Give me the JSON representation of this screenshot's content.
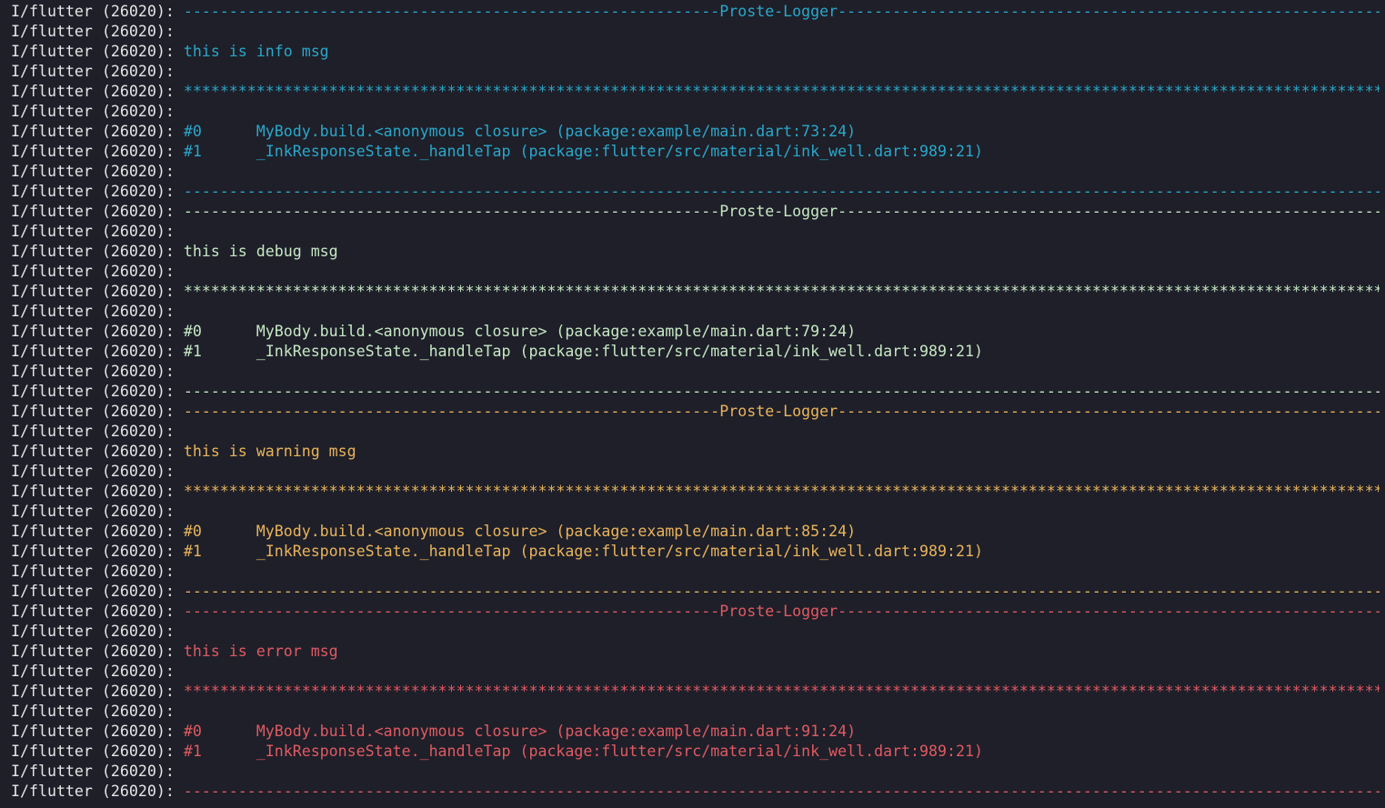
{
  "console": {
    "prefix": "I/flutter (26020): ",
    "colors": {
      "prefix": "#e6e6e6",
      "info": "#2aa7c9",
      "debug": "#c7e8c3",
      "warning": "#e9b45b",
      "error": "#e05a62"
    },
    "lines": [
      {
        "text": "-----------------------------------------------------------Proste-Logger-------------------------------------------------------------",
        "level": "info"
      },
      {
        "text": "",
        "level": "info"
      },
      {
        "text": "this is info msg",
        "level": "info"
      },
      {
        "text": "",
        "level": "info"
      },
      {
        "text": "************************************************************************************************************************************",
        "level": "info"
      },
      {
        "text": "",
        "level": "info"
      },
      {
        "text": "#0      MyBody.build.<anonymous closure> (package:example/main.dart:73:24)",
        "level": "info"
      },
      {
        "text": "#1      _InkResponseState._handleTap (package:flutter/src/material/ink_well.dart:989:21)",
        "level": "info"
      },
      {
        "text": "",
        "level": "info"
      },
      {
        "text": "------------------------------------------------------------------------------------------------------------------------------------",
        "level": "info"
      },
      {
        "text": "-----------------------------------------------------------Proste-Logger-------------------------------------------------------------",
        "level": "debug"
      },
      {
        "text": "",
        "level": "debug"
      },
      {
        "text": "this is debug msg",
        "level": "debug"
      },
      {
        "text": "",
        "level": "debug"
      },
      {
        "text": "************************************************************************************************************************************",
        "level": "debug"
      },
      {
        "text": "",
        "level": "debug"
      },
      {
        "text": "#0      MyBody.build.<anonymous closure> (package:example/main.dart:79:24)",
        "level": "debug"
      },
      {
        "text": "#1      _InkResponseState._handleTap (package:flutter/src/material/ink_well.dart:989:21)",
        "level": "debug"
      },
      {
        "text": "",
        "level": "debug"
      },
      {
        "text": "------------------------------------------------------------------------------------------------------------------------------------",
        "level": "debug"
      },
      {
        "text": "-----------------------------------------------------------Proste-Logger-------------------------------------------------------------",
        "level": "warning"
      },
      {
        "text": "",
        "level": "warning"
      },
      {
        "text": "this is warning msg",
        "level": "warning"
      },
      {
        "text": "",
        "level": "warning"
      },
      {
        "text": "************************************************************************************************************************************",
        "level": "warning"
      },
      {
        "text": "",
        "level": "warning"
      },
      {
        "text": "#0      MyBody.build.<anonymous closure> (package:example/main.dart:85:24)",
        "level": "warning"
      },
      {
        "text": "#1      _InkResponseState._handleTap (package:flutter/src/material/ink_well.dart:989:21)",
        "level": "warning"
      },
      {
        "text": "",
        "level": "warning"
      },
      {
        "text": "------------------------------------------------------------------------------------------------------------------------------------",
        "level": "warning"
      },
      {
        "text": "-----------------------------------------------------------Proste-Logger-------------------------------------------------------------",
        "level": "error"
      },
      {
        "text": "",
        "level": "error"
      },
      {
        "text": "this is error msg",
        "level": "error"
      },
      {
        "text": "",
        "level": "error"
      },
      {
        "text": "************************************************************************************************************************************",
        "level": "error"
      },
      {
        "text": "",
        "level": "error"
      },
      {
        "text": "#0      MyBody.build.<anonymous closure> (package:example/main.dart:91:24)",
        "level": "error"
      },
      {
        "text": "#1      _InkResponseState._handleTap (package:flutter/src/material/ink_well.dart:989:21)",
        "level": "error"
      },
      {
        "text": "",
        "level": "error"
      },
      {
        "text": "------------------------------------------------------------------------------------------------------------------------------------",
        "level": "error"
      }
    ]
  }
}
